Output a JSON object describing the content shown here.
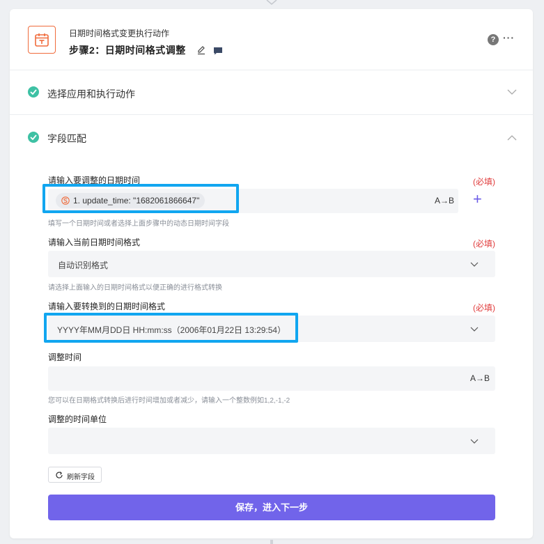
{
  "header": {
    "subtitle": "日期时间格式变更执行动作",
    "title": "步骤2：日期时间格式调整",
    "help": "?",
    "more": "···"
  },
  "sections": {
    "app_action": {
      "title": "选择应用和执行动作"
    },
    "field_mapping": {
      "title": "字段匹配"
    }
  },
  "fields": {
    "datetime": {
      "label": "请输入要调整的日期时间",
      "required": "(必填)",
      "token": "1. update_time: \"1682061866647\"",
      "ab": "A→B",
      "hint": "填写一个日期时间或者选择上面步骤中的动态日期时间字段"
    },
    "current_format": {
      "label": "请输入当前日期时间格式",
      "required": "(必填)",
      "value": "自动识别格式",
      "hint": "请选择上面输入的日期时间格式以便正确的进行格式转换"
    },
    "target_format": {
      "label": "请输入要转换到的日期时间格式",
      "required": "(必填)",
      "value": "YYYY年MM月DD日 HH:mm:ss（2006年01月22日 13:29:54）"
    },
    "adjust_time": {
      "label": "调整时间",
      "ab": "A→B",
      "hint": "您可以在日期格式转换后进行时间增加或者减少，请输入一个整数例如1,2,-1,-2"
    },
    "time_unit": {
      "label": "调整的时间单位",
      "value": ""
    }
  },
  "buttons": {
    "refresh": "刷新字段",
    "save": "保存，进入下一步"
  },
  "colors": {
    "accent": "#7164ea",
    "success": "#3ec1a4",
    "required": "#e03b3b",
    "highlight": "#11a6f0",
    "app_icon": "#f06b3b"
  }
}
